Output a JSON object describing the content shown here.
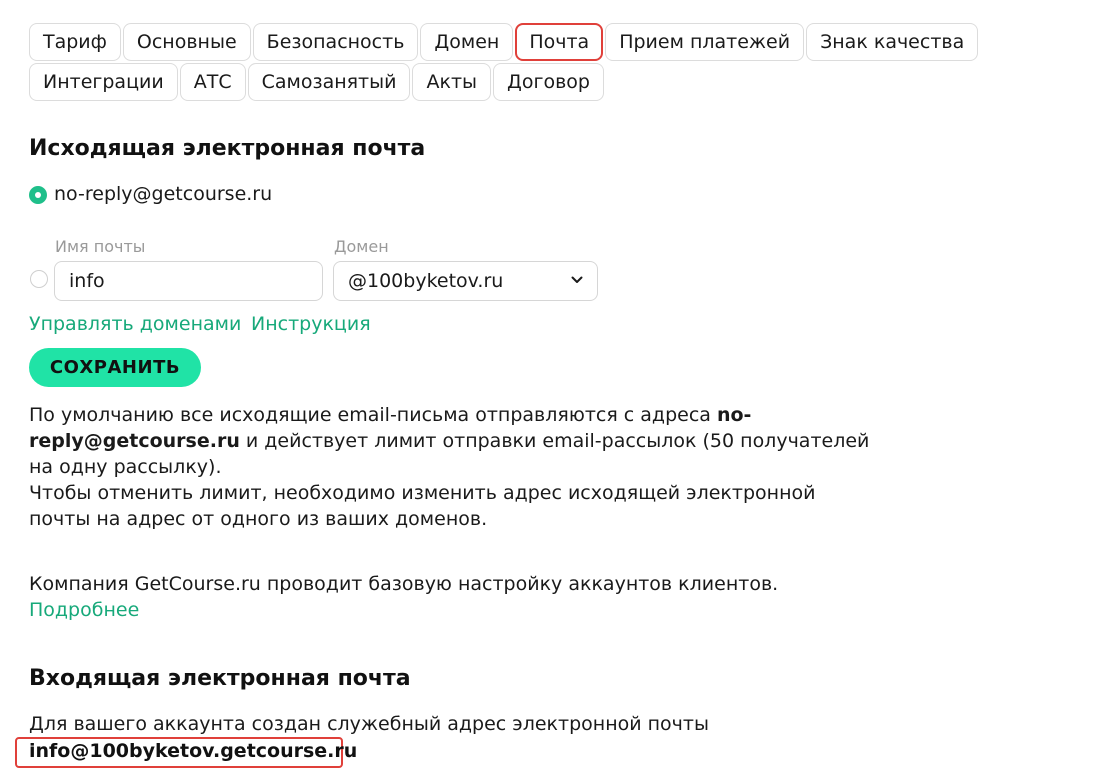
{
  "tabs": [
    {
      "label": "Тариф"
    },
    {
      "label": "Основные"
    },
    {
      "label": "Безопасность"
    },
    {
      "label": "Домен"
    },
    {
      "label": "Почта",
      "active": true
    },
    {
      "label": "Прием платежей"
    },
    {
      "label": "Знак качества"
    },
    {
      "label": "Интеграции"
    },
    {
      "label": "АТС"
    },
    {
      "label": "Самозанятый"
    },
    {
      "label": "Акты"
    },
    {
      "label": "Договор"
    }
  ],
  "outgoing": {
    "title": "Исходящая электронная почта",
    "default_option": "no-reply@getcourse.ru",
    "mail_name_label": "Имя почты",
    "mail_name_value": "info",
    "domain_label": "Домен",
    "domain_value": "@100byketov.ru",
    "manage_domains_link": "Управлять доменами",
    "instruction_link": "Инструкция",
    "save_button": "СОХРАНИТЬ",
    "info_part1": "По умолчанию все исходящие email-письма отправляются с адреса ",
    "info_bold": "no-reply@getcourse.ru",
    "info_part2": " и действует лимит отправки email-рассылок (50 получателей на одну рассылку).",
    "info_line2": "Чтобы отменить лимит, необходимо изменить адрес исходящей электронной почты на адрес от одного из ваших доменов.",
    "company_text": "Компания GetCourse.ru проводит базовую настройку аккаунтов клиентов.",
    "more_link": "Подробнее"
  },
  "incoming": {
    "title": "Входящая электронная почта",
    "description": "Для вашего аккаунта создан служебный адрес электронной почты",
    "address": "info@100byketov.getcourse.ru"
  },
  "colors": {
    "accent": "#20e3a6",
    "link": "#17a97a",
    "highlight": "#e0403a"
  }
}
